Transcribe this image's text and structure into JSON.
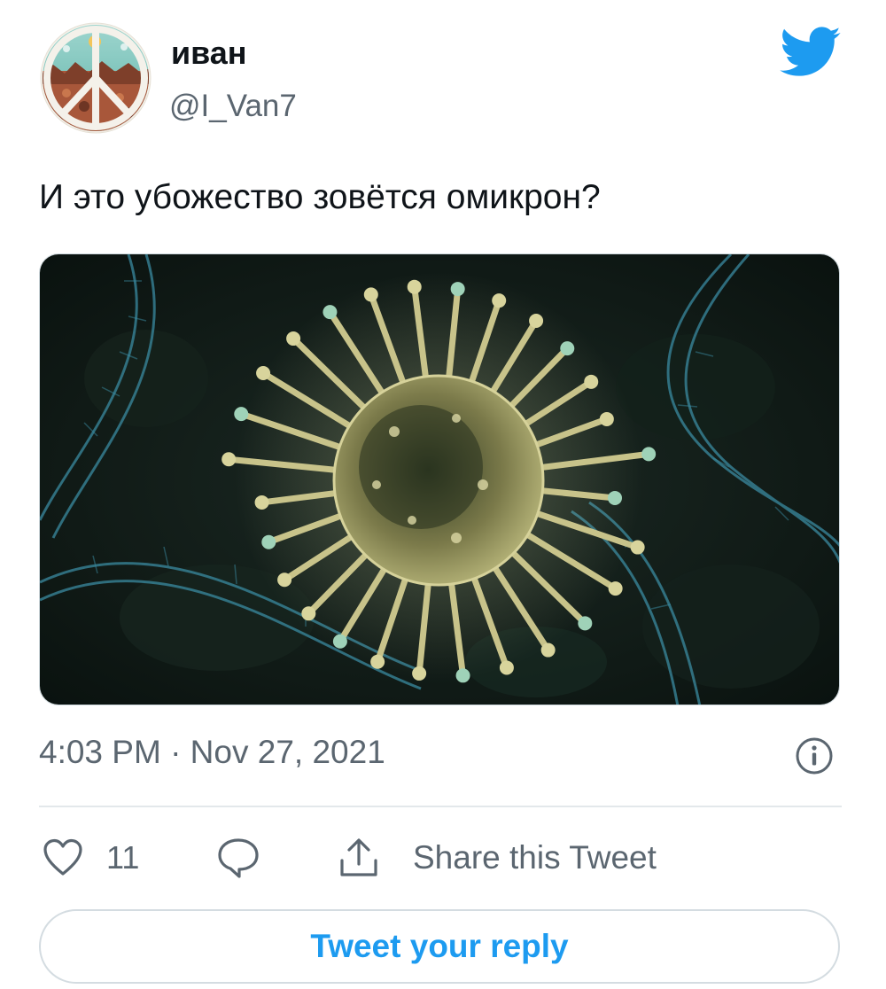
{
  "user": {
    "display_name": "иван",
    "handle": "@I_Van7",
    "avatar_icon": "peace-sign-avatar"
  },
  "brand": {
    "icon": "twitter-bird-icon",
    "color": "#1d9bf0"
  },
  "tweet": {
    "text": "И это убожество зовётся омикрон?",
    "media_description_icon": "virus-image",
    "timestamp": "4:03 PM · Nov 27, 2021"
  },
  "actions": {
    "like_icon": "heart-icon",
    "like_count": "11",
    "reply_icon": "speech-bubble-icon",
    "share_icon": "share-upload-icon",
    "share_label": "Share this Tweet",
    "info_icon": "info-icon"
  },
  "reply": {
    "button_label": "Tweet your reply"
  },
  "colors": {
    "text_primary": "#0f1419",
    "text_secondary": "#5b6670",
    "accent": "#1d9bf0",
    "divider": "#e3e8eb"
  }
}
